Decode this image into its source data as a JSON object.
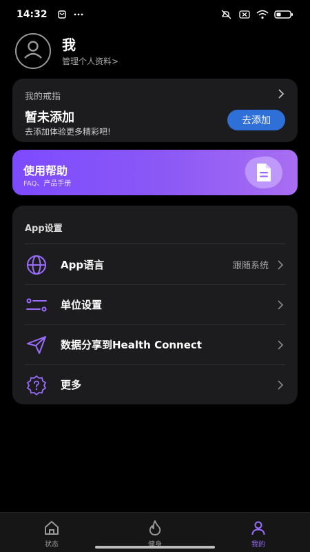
{
  "status_bar": {
    "time": "14:32",
    "left_icons": [
      "notification-icon",
      "more-dots-icon"
    ],
    "right_icons": [
      "mute-icon",
      "no-sim-icon",
      "wifi-icon",
      "battery-icon"
    ]
  },
  "profile": {
    "name": "我",
    "subtitle": "管理个人资料>"
  },
  "ring_card": {
    "label": "我的戒指",
    "title": "暂未添加",
    "description": "去添加体验更多精彩吧!",
    "button_label": "去添加"
  },
  "help_banner": {
    "title": "使用帮助",
    "subtitle": "FAQ、产品手册"
  },
  "settings": {
    "header": "App设置",
    "items": [
      {
        "label": "App语言",
        "value": "跟随系统",
        "icon": "globe-icon"
      },
      {
        "label": "单位设置",
        "value": "",
        "icon": "sliders-icon"
      },
      {
        "label": "数据分享到Health Connect",
        "value": "",
        "icon": "send-icon"
      },
      {
        "label": "更多",
        "value": "",
        "icon": "help-badge-icon"
      }
    ]
  },
  "bottom_nav": {
    "items": [
      {
        "label": "状态",
        "icon": "home-icon",
        "active": false
      },
      {
        "label": "健身",
        "icon": "flame-icon",
        "active": false
      },
      {
        "label": "我的",
        "icon": "person-icon",
        "active": true
      }
    ]
  },
  "colors": {
    "accent": "#9b6dff",
    "button_blue": "#2f6fd8",
    "card_bg": "#1c1c1e"
  }
}
